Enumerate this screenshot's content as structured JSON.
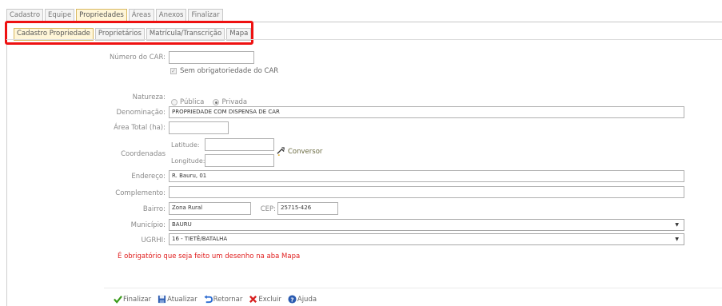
{
  "main_tabs": [
    "Cadastro",
    "Equipe",
    "Propriedades",
    "Áreas",
    "Anexos",
    "Finalizar"
  ],
  "sub_tabs": [
    "Cadastro Propriedade",
    "Proprietários",
    "Matrícula/Transcrição",
    "Mapa"
  ],
  "form": {
    "car_label": "Número do CAR:",
    "car_value": "",
    "sem_car_label": "Sem obrigatoriedade do CAR",
    "natureza_label": "Natureza:",
    "natureza_publica": "Pública",
    "natureza_privada": "Privada",
    "natureza_selected": "Privada",
    "denominacao_label": "Denominação:",
    "denominacao_value": "PROPRIEDADE COM DISPENSA DE CAR",
    "area_label": "Área Total (ha):",
    "area_value": "",
    "coordenadas_label": "Coordenadas",
    "latitude_label": "Latitude:",
    "longitude_label": "Longitude:",
    "latitude_value": "",
    "longitude_value": "",
    "conversor_label": "Conversor",
    "endereco_label": "Endereço:",
    "endereco_value": "R. Bauru, 01",
    "complemento_label": "Complemento:",
    "complemento_value": "",
    "bairro_label": "Bairro:",
    "bairro_value": "Zona Rural",
    "cep_label": "CEP:",
    "cep_value": "25715-426",
    "municipio_label": "Município:",
    "municipio_value": "BAURU",
    "ugrhi_label": "UGRHI:",
    "ugrhi_value": "16 - TIETÊ/BATALHA"
  },
  "error_message": "É obrigatório que seja feito um desenho na aba Mapa",
  "actions": {
    "finalizar": "Finalizar",
    "atualizar": "Atualizar",
    "retornar": "Retornar",
    "excluir": "Excluir",
    "ajuda": "Ajuda"
  },
  "colors": {
    "highlight": "#ee1111",
    "active_tab_bg": "#fff6d8",
    "error_text": "#e02020"
  }
}
